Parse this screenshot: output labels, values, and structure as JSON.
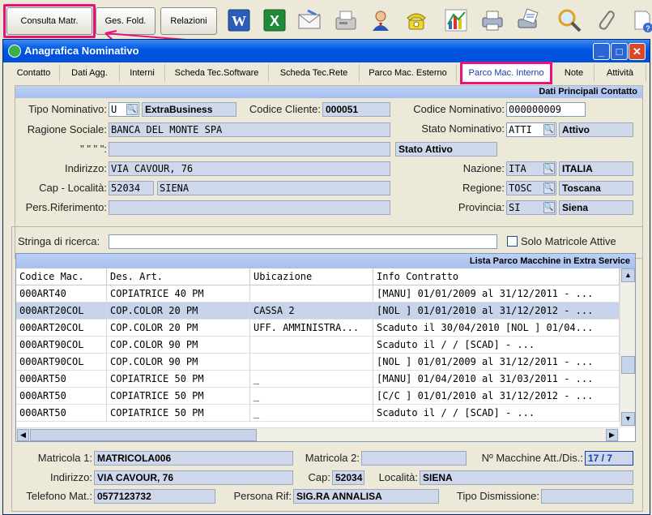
{
  "toolbar": {
    "buttons": [
      "Consulta Matr.",
      "Ges. Fold.",
      "Relazioni"
    ],
    "icons": [
      "word-icon",
      "excel-icon",
      "email-icon",
      "fax-icon",
      "user-icon",
      "phone-icon",
      "chart-icon",
      "printer-icon",
      "print-preview-icon",
      "search-icon",
      "attachment-icon",
      "help-icon"
    ]
  },
  "window": {
    "title": "Anagrafica Nominativo",
    "controls": {
      "minimize": "_",
      "maximize": "□",
      "close": "✕"
    }
  },
  "tabs": [
    "Contatto",
    "Dati Agg.",
    "Interni",
    "Scheda Tec.Software",
    "Scheda Tec.Rete",
    "Parco Mac. Esterno",
    "Parco Mac. Interno",
    "Note",
    "Attività"
  ],
  "active_tab": "Parco Mac. Interno",
  "contact": {
    "header": "Dati Principali Contatto",
    "tipo_nominativo_label": "Tipo Nominativo:",
    "tipo_nominativo_code": "U",
    "tipo_nominativo_desc": "ExtraBusiness",
    "codice_cliente_label": "Codice Cliente:",
    "codice_cliente": "000051",
    "codice_nominativo_label": "Codice Nominativo:",
    "codice_nominativo": "000000009",
    "ragione_sociale_label": "Ragione Sociale:",
    "ragione_sociale": "BANCA DEL MONTE SPA",
    "stato_nominativo_label": "Stato Nominativo:",
    "stato_nominativo_code": "ATTI",
    "stato_nominativo_desc": "Attivo",
    "ditto_label": "\"  \"  \"  \":",
    "ditto_value": "",
    "stato_attivo": "Stato Attivo",
    "indirizzo_label": "Indirizzo:",
    "indirizzo": "VIA CAVOUR, 76",
    "nazione_label": "Nazione:",
    "nazione_code": "ITA",
    "nazione_desc": "ITALIA",
    "cap_label": "Cap - Località:",
    "cap": "52034",
    "localita": "SIENA",
    "regione_label": "Regione:",
    "regione_code": "TOSC",
    "regione_desc": "Toscana",
    "pers_label": "Pers.Riferimento:",
    "pers_value": "",
    "provincia_label": "Provincia:",
    "provincia_code": "SI",
    "provincia_desc": "Siena"
  },
  "search": {
    "label": "Stringa di ricerca:",
    "value": "",
    "checkbox_label": "Solo Matricole Attive",
    "checked": false
  },
  "grid": {
    "header": "Lista Parco Macchine in Extra Service",
    "columns": [
      "Codice Mac.",
      "Des. Art.",
      "Ubicazione",
      "Info Contratto"
    ],
    "rows": [
      [
        "000ART40",
        "COPIATRICE 40 PM",
        "",
        "[MANU] 01/01/2009 al 31/12/2011 - ..."
      ],
      [
        "000ART20COL",
        "COP.COLOR 20 PM",
        "CASSA 2",
        "[NOL ] 01/01/2010 al 31/12/2012 - ..."
      ],
      [
        "000ART20COL",
        "COP.COLOR 20 PM",
        "UFF. AMMINISTRA...",
        "Scaduto il 30/04/2010 [NOL ] 01/04..."
      ],
      [
        "000ART90COL",
        "COP.COLOR 90 PM",
        "",
        "Scaduto il   /  /     [SCAD]    - ..."
      ],
      [
        "000ART90COL",
        "COP.COLOR 90 PM",
        "",
        "[NOL ] 01/01/2009 al 31/12/2011 - ..."
      ],
      [
        "000ART50",
        "COPIATRICE 50 PM",
        "_",
        "[MANU] 01/04/2010 al 31/03/2011 - ..."
      ],
      [
        "000ART50",
        "COPIATRICE 50 PM",
        "_",
        "[C/C ] 01/01/2010 al 31/12/2012 - ..."
      ],
      [
        "000ART50",
        "COPIATRICE 50 PM",
        "_",
        "Scaduto il   /  /     [SCAD]    - ..."
      ]
    ],
    "selected_row": 1
  },
  "detail": {
    "matricola1_label": "Matricola 1:",
    "matricola1": "MATRICOLA006",
    "matricola2_label": "Matricola 2:",
    "matricola2": "",
    "nmacchine_label": "Nº Macchine Att./Dis.:",
    "nmacchine": "17 /  7",
    "indirizzo_label": "Indirizzo:",
    "indirizzo": "VIA CAVOUR, 76",
    "cap_label": "Cap:",
    "cap": "52034",
    "localita_label": "Località:",
    "localita": "SIENA",
    "telefono_label": "Telefono Mat.:",
    "telefono": "0577123732",
    "persona_label": "Persona Rif:",
    "persona": "SIG.RA ANNALISA",
    "tipo_dism_label": "Tipo Dismissione:",
    "tipo_dism": ""
  },
  "colors": {
    "highlight": "#e8127a",
    "titlebar": "#0054e3",
    "selected_row": "#c7d3ea",
    "field": "#cfd8ea"
  }
}
